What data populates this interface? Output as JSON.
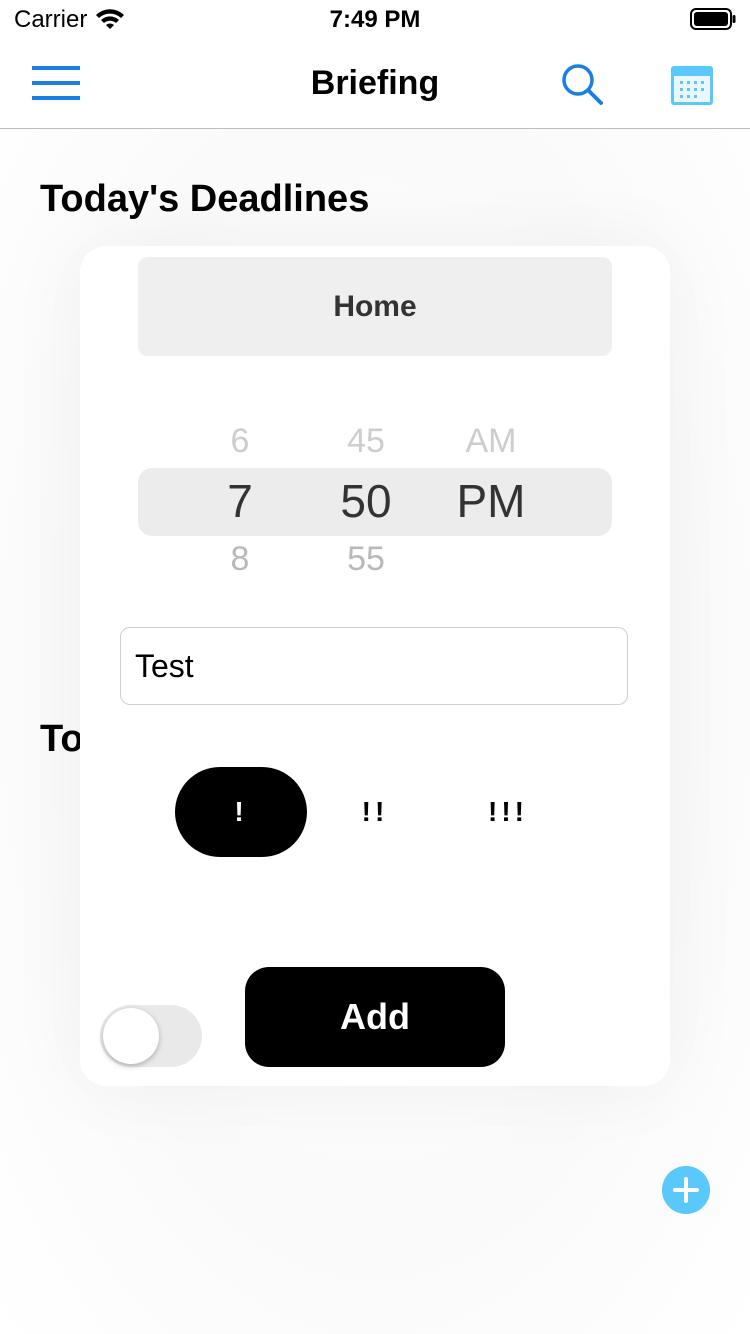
{
  "status_bar": {
    "carrier": "Carrier",
    "time": "7:49 PM"
  },
  "nav": {
    "title": "Briefing",
    "icons": [
      "menu-icon",
      "search-icon",
      "calendar-icon"
    ]
  },
  "sections": {
    "deadlines_title": "Today's Deadlines",
    "todos_title_partial": "To"
  },
  "card": {
    "category_label": "Home",
    "time_picker": {
      "hour": {
        "above": "6",
        "selected": "7",
        "below": "8"
      },
      "minute": {
        "above": "45",
        "selected": "50",
        "below": "55"
      },
      "period": {
        "above": "AM",
        "selected": "PM"
      }
    },
    "task_input_value": "Test",
    "priority_options": [
      "!",
      "!!",
      "!!!"
    ],
    "priority_selected": "!",
    "toggle_on": false,
    "add_label": "Add"
  },
  "colors": {
    "accent_blue": "#1a7fe0",
    "fab_blue": "#5ac8fa",
    "selected_priority": "#000000"
  }
}
